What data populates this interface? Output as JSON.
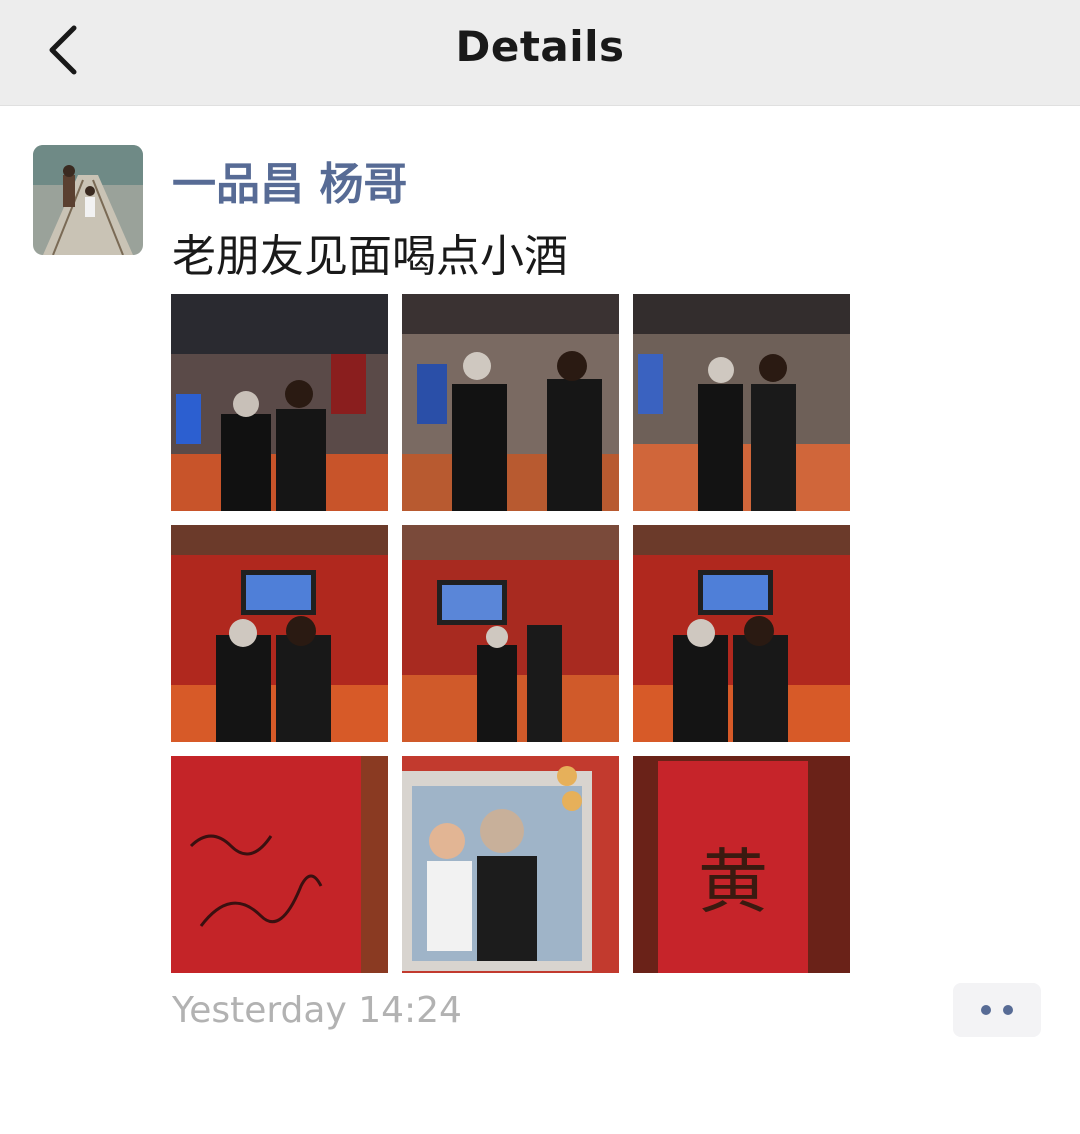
{
  "header": {
    "title": "Details",
    "back_icon": "chevron-left-icon"
  },
  "post": {
    "author": "一品昌 杨哥",
    "text": "老朋友见面喝点小酒",
    "timestamp": "Yesterday 14:24",
    "more_icon": "more-dots-icon",
    "photos": [
      {
        "scene": "bar-interior"
      },
      {
        "scene": "bar-interior"
      },
      {
        "scene": "bar-interior"
      },
      {
        "scene": "red-decor"
      },
      {
        "scene": "red-decor"
      },
      {
        "scene": "red-decor"
      },
      {
        "scene": "signed-red-card"
      },
      {
        "scene": "signed-photo"
      },
      {
        "scene": "red-card-character",
        "character": "黄"
      }
    ]
  },
  "colors": {
    "link": "#576b95",
    "navbar_bg": "#ededed",
    "timestamp": "#b2b2b2"
  }
}
